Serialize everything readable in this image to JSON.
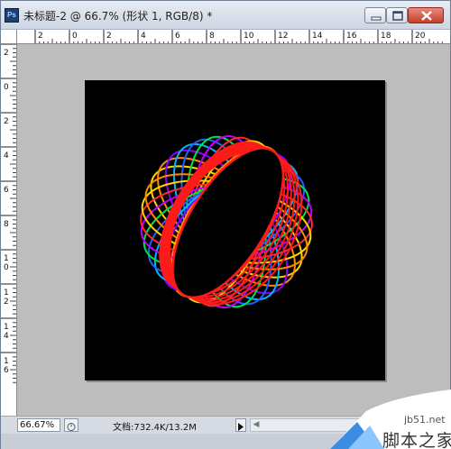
{
  "app": {
    "icon_label": "Ps",
    "window_title": "未标题-2 @ 66.7% (形状 1, RGB/8) *"
  },
  "rulers": {
    "horizontal_labels": [
      "2",
      "0",
      "2",
      "4",
      "6",
      "8",
      "10",
      "12",
      "14",
      "16",
      "18",
      "20"
    ],
    "vertical_labels": [
      "2",
      "0",
      "2",
      "4",
      "6",
      "8",
      "10",
      "12",
      "14",
      "16"
    ]
  },
  "status": {
    "zoom": "66.67%",
    "doc_info": "文档:732.4K/13.2M"
  },
  "artwork": {
    "ring_colors": [
      "#ffd400",
      "#ff8a00",
      "#8a00ff",
      "#00b4ff",
      "#2060ff",
      "#00e050",
      "#c000ff",
      "#ff2a2a"
    ],
    "outline_color": "#ff1a1a"
  },
  "watermark": {
    "site": "jb51.net",
    "name": "脚本之家"
  }
}
